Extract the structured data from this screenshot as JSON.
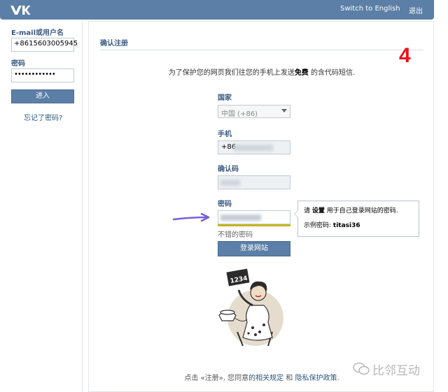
{
  "header": {
    "logo": "VK",
    "switch_language": "Switch to English",
    "logout": "退出"
  },
  "login": {
    "email_label": "E-mail或用户名",
    "email_value": "+8615603005945",
    "password_label": "密码",
    "password_value": "••••••••••••",
    "login_button": "进入",
    "forgot_link": "忘记了密码?"
  },
  "main": {
    "section_title": "确认注册",
    "step_number": "4",
    "intro_before": "为了保护您的网页我们往您的手机上发送",
    "intro_bold": "免费",
    "intro_after": "的含代码短信.",
    "country_label": "国家",
    "country_value": "中国 (+86)",
    "phone_label": "手机",
    "phone_value": "+86",
    "code_label": "确认码",
    "password_label": "密码",
    "strength_text": "不错的密码",
    "submit_button": "登录网站",
    "tooltip": {
      "line1_pre": "请",
      "line1_bold": "设置",
      "line1_post": "用于自己登录网站的密码.",
      "line2_pre": "示例密码:",
      "line2_bold": "titasi36"
    },
    "illustration_number": "1234",
    "footer_pre": "点击 «注册», 您同意",
    "footer_link1": "的相关规定",
    "footer_mid": "和",
    "footer_link2": "隐私保护政策",
    "footer_post": "."
  },
  "watermark": {
    "text": "比邻互动"
  },
  "colors": {
    "brand_blue": "#5b7fa6",
    "label_blue": "#3b5b82",
    "step_red": "#e8141b",
    "annotation_purple": "#7a5fd8",
    "strength_bar": "#c7b421"
  }
}
